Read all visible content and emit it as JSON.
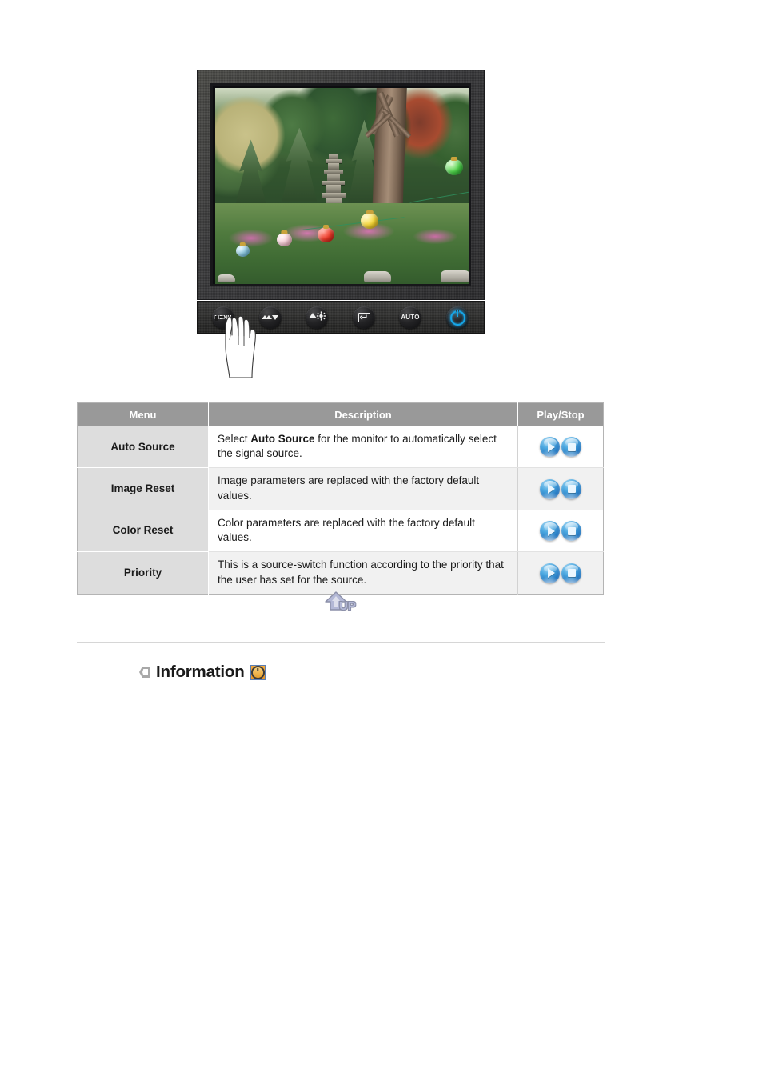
{
  "figure": {
    "name": "monitor-front-illustration",
    "alt": "LCD monitor displaying a garden photo with a hand pressing the MENU button",
    "screen_image_description": "Korean garden with stone pagodas, pine trees, azalea shrubs and colored paper lanterns strung from a large tree",
    "buttons": [
      {
        "id": "menu",
        "label": "MENU",
        "icon": "menu-osd-icon"
      },
      {
        "id": "volume",
        "label": "",
        "icon": "volume-down-icon"
      },
      {
        "id": "brightness",
        "label": "",
        "icon": "brightness-up-icon"
      },
      {
        "id": "enter",
        "label": "",
        "icon": "enter-icon"
      },
      {
        "id": "auto",
        "label": "AUTO",
        "icon": "auto-adjust-icon"
      },
      {
        "id": "power",
        "label": "",
        "icon": "power-icon"
      }
    ]
  },
  "table": {
    "name": "osd-menu-table",
    "headers": [
      "Menu",
      "Description",
      "Play/Stop"
    ],
    "rows": [
      {
        "menu": "Auto Source",
        "description_pre": "Select ",
        "description_bold": "Auto Source",
        "description_post": " for the monitor to automatically select the signal source.",
        "play_label": "Play",
        "stop_label": "Stop"
      },
      {
        "menu": "Image Reset",
        "description_pre": "Image parameters are replaced with the factory default values.",
        "description_bold": "",
        "description_post": "",
        "play_label": "Play",
        "stop_label": "Stop"
      },
      {
        "menu": "Color Reset",
        "description_pre": "Color parameters are replaced with the factory default values.",
        "description_bold": "",
        "description_post": "",
        "play_label": "Play",
        "stop_label": "Stop"
      },
      {
        "menu": "Priority",
        "description_pre": "This is a source-switch function according to the priority that the user has set for the source.",
        "description_bold": "",
        "description_post": "",
        "play_label": "Play",
        "stop_label": "Stop"
      }
    ]
  },
  "up_button": {
    "label": "UP",
    "icon": "up-arrow-icon"
  },
  "information_section": {
    "bullet_icon": "chevron-bullet-icon",
    "title": "Information",
    "badge_icon": "clock-icon"
  },
  "colors": {
    "table_header_bg": "#999999",
    "table_header_text": "#ffffff",
    "menu_cell_bg": "#dddddd",
    "row_alt_bg": "#f1f1f1",
    "table_border": "#b4b4b4",
    "divider": "#d6d6d6",
    "orb_blue": "#1f72bd",
    "badge_orange": "#efa033",
    "up_arrow": "#b3b8d6",
    "power_led": "#16a6e8"
  }
}
